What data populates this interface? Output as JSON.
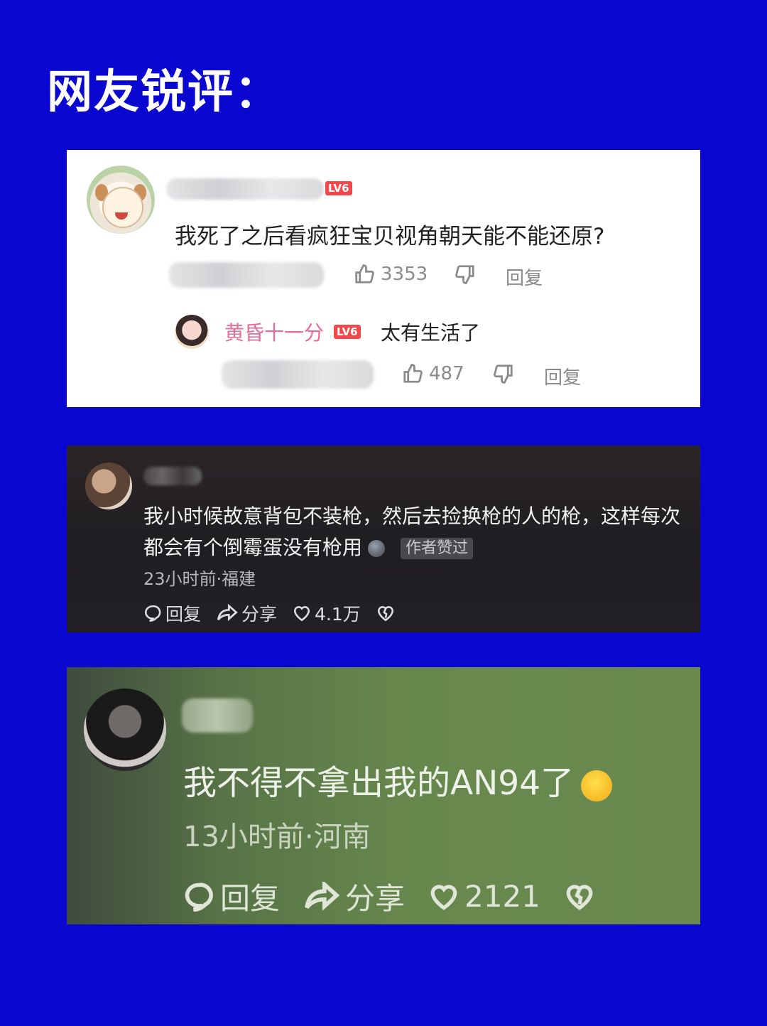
{
  "page": {
    "title": "网友锐评："
  },
  "card1": {
    "level_badge": "LV6",
    "comment_text": "我死了之后看疯狂宝贝视角朝天能不能还原?",
    "like_count": "3353",
    "reply_label": "回复",
    "reply": {
      "username": "黄昏十一分",
      "level_badge": "LV6",
      "text": "太有生活了",
      "like_count": "487",
      "reply_label": "回复"
    }
  },
  "card2": {
    "comment_text": "我小时候故意背包不装枪，然后去捡换枪的人的枪，这样每次都会有个倒霉蛋没有枪用",
    "author_tag": "作者赞过",
    "time_location": "23小时前·福建",
    "reply_label": "回复",
    "share_label": "分享",
    "like_count": "4.1万"
  },
  "card3": {
    "comment_text": "我不得不拿出我的AN94了",
    "time_location": "13小时前·河南",
    "reply_label": "回复",
    "share_label": "分享",
    "like_count": "2121"
  }
}
